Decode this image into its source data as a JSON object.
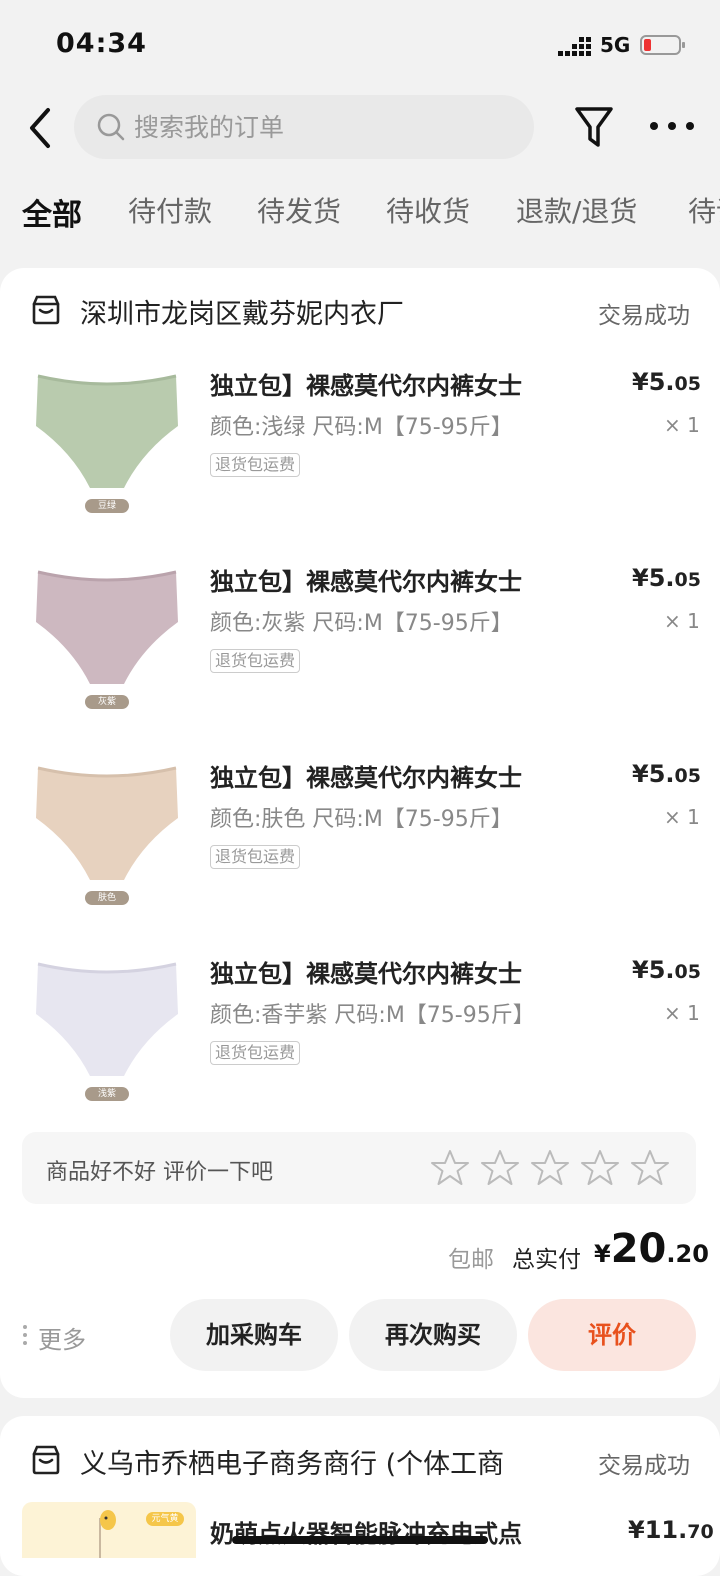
{
  "status_bar": {
    "time": "04:34",
    "network": "5G"
  },
  "header": {
    "search_placeholder": "搜索我的订单"
  },
  "tabs": [
    "全部",
    "待付款",
    "待发货",
    "待收货",
    "退款/退货",
    "待评"
  ],
  "order1": {
    "shop": "深圳市龙岗区戴芬妮内衣厂",
    "status": "交易成功",
    "items": [
      {
        "title": "独立包】裸感莫代尔内裤女士",
        "spec": "颜色:浅绿 尺码:M【75-95斤】",
        "tag": "退货包运费",
        "price_main": "¥5.",
        "price_dec": "05",
        "qty": "× 1",
        "swatch_label": "豆绿",
        "color": "#b9cbae"
      },
      {
        "title": "独立包】裸感莫代尔内裤女士",
        "spec": "颜色:灰紫 尺码:M【75-95斤】",
        "tag": "退货包运费",
        "price_main": "¥5.",
        "price_dec": "05",
        "qty": "× 1",
        "swatch_label": "灰紫",
        "color": "#cdb8c0"
      },
      {
        "title": "独立包】裸感莫代尔内裤女士",
        "spec": "颜色:肤色 尺码:M【75-95斤】",
        "tag": "退货包运费",
        "price_main": "¥5.",
        "price_dec": "05",
        "qty": "× 1",
        "swatch_label": "肤色",
        "color": "#e7d2bf"
      },
      {
        "title": "独立包】裸感莫代尔内裤女士",
        "spec": "颜色:香芋紫 尺码:M【75-95斤】",
        "tag": "退货包运费",
        "price_main": "¥5.",
        "price_dec": "05",
        "qty": "× 1",
        "swatch_label": "浅紫",
        "color": "#e7e6f0"
      }
    ],
    "review_prompt": "商品好不好 评价一下吧",
    "shipping": "包邮",
    "total_label": "总实付",
    "total_currency": "¥",
    "total_main": "20",
    "total_dec": ".20",
    "more": "更多",
    "buttons": {
      "cart": "加采购车",
      "rebuy": "再次购买",
      "review": "评价"
    }
  },
  "order2": {
    "shop": "义乌市乔栖电子商务商行 (个体工商",
    "status": "交易成功",
    "item_title": "奶萌点火器智能脉冲充电式点",
    "item_price_main": "¥11.",
    "item_price_dec": "70",
    "thumb_badge": "元气黄"
  },
  "colors": {
    "accent": "#e8511d",
    "accent_bg": "#fbe5df"
  }
}
